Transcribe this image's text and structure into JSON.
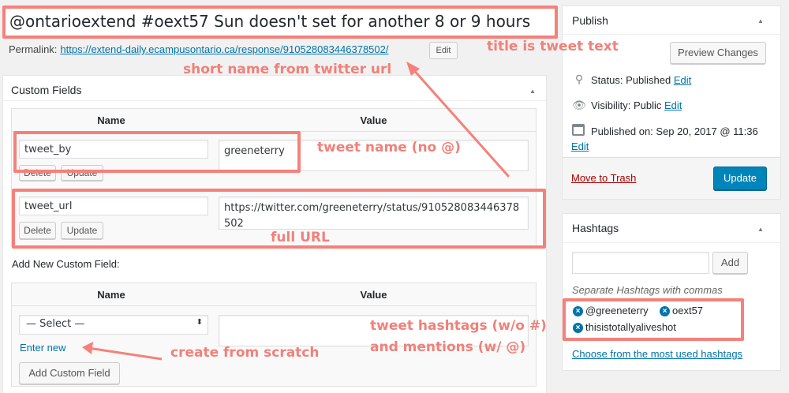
{
  "post": {
    "title": "@ontarioextend #oext57 Sun doesn't set for another 8 or 9 hours",
    "permalink_label": "Permalink:",
    "permalink_url": "https://extend-daily.ecampusontario.ca/response/910528083446378502/",
    "permalink_edit": "Edit"
  },
  "custom_fields": {
    "title": "Custom Fields",
    "col_name": "Name",
    "col_value": "Value",
    "rows": [
      {
        "name": "tweet_by",
        "value": "greeneterry",
        "delete": "Delete",
        "update": "Update"
      },
      {
        "name": "tweet_url",
        "value": "https://twitter.com/greeneterry/status/910528083446378502",
        "delete": "Delete",
        "update": "Update"
      }
    ],
    "add_new_label": "Add New Custom Field:",
    "select_value": "— Select —",
    "enter_new": "Enter new",
    "add_button": "Add Custom Field"
  },
  "publish": {
    "title": "Publish",
    "preview_button": "Preview Changes",
    "status_label": "Status: Published",
    "visibility_label": "Visibility: Public",
    "published_label": "Published on: Sep 20, 2017 @ 11:36",
    "edit": "Edit",
    "trash": "Move to Trash",
    "update_button": "Update"
  },
  "hashtags": {
    "title": "Hashtags",
    "add_button": "Add",
    "hint": "Separate Hashtags with commas",
    "tags": [
      "@greeneterry",
      "oext57",
      "thisistotallyaliveshot"
    ],
    "most_used_link": "Choose from the most used hashtags"
  },
  "annotations": {
    "title_note": "title is tweet text",
    "short_name": "short name from twitter url",
    "tweet_name": "tweet name (no @)",
    "full_url": "full URL",
    "create": "create from scratch",
    "hashtags_line1": "tweet hashtags (w/o #)",
    "hashtags_line2": "and mentions (w/ @)"
  },
  "colors": {
    "annotation": "#f0817a",
    "primary_button": "#0085ba",
    "link": "#0073aa"
  }
}
